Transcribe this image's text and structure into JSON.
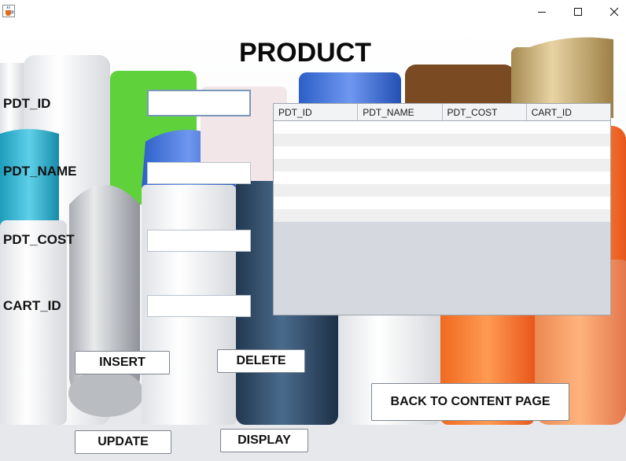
{
  "window": {
    "minimize_icon": "minimize-icon",
    "maximize_icon": "maximize-icon",
    "close_icon": "close-icon",
    "app_icon": "java-coffee-cup-icon"
  },
  "heading": "PRODUCT",
  "form": {
    "pdt_id_label": "PDT_ID",
    "pdt_name_label": "PDT_NAME",
    "pdt_cost_label": "PDT_COST",
    "cart_id_label": "CART_ID",
    "pdt_id_value": "",
    "pdt_name_value": "",
    "pdt_cost_value": "",
    "cart_id_value": ""
  },
  "table": {
    "columns": [
      "PDT_ID",
      "PDT_NAME",
      "PDT_COST",
      "CART_ID"
    ],
    "rows": []
  },
  "buttons": {
    "insert": "INSERT",
    "delete": "DELETE",
    "update": "UPDATE",
    "display": "DISPLAY",
    "back": "BACK TO CONTENT PAGE"
  },
  "colors": {
    "table_bg": "#d5d8df",
    "header_bg": "#f2f3f5",
    "row_alt": "#efefef"
  }
}
